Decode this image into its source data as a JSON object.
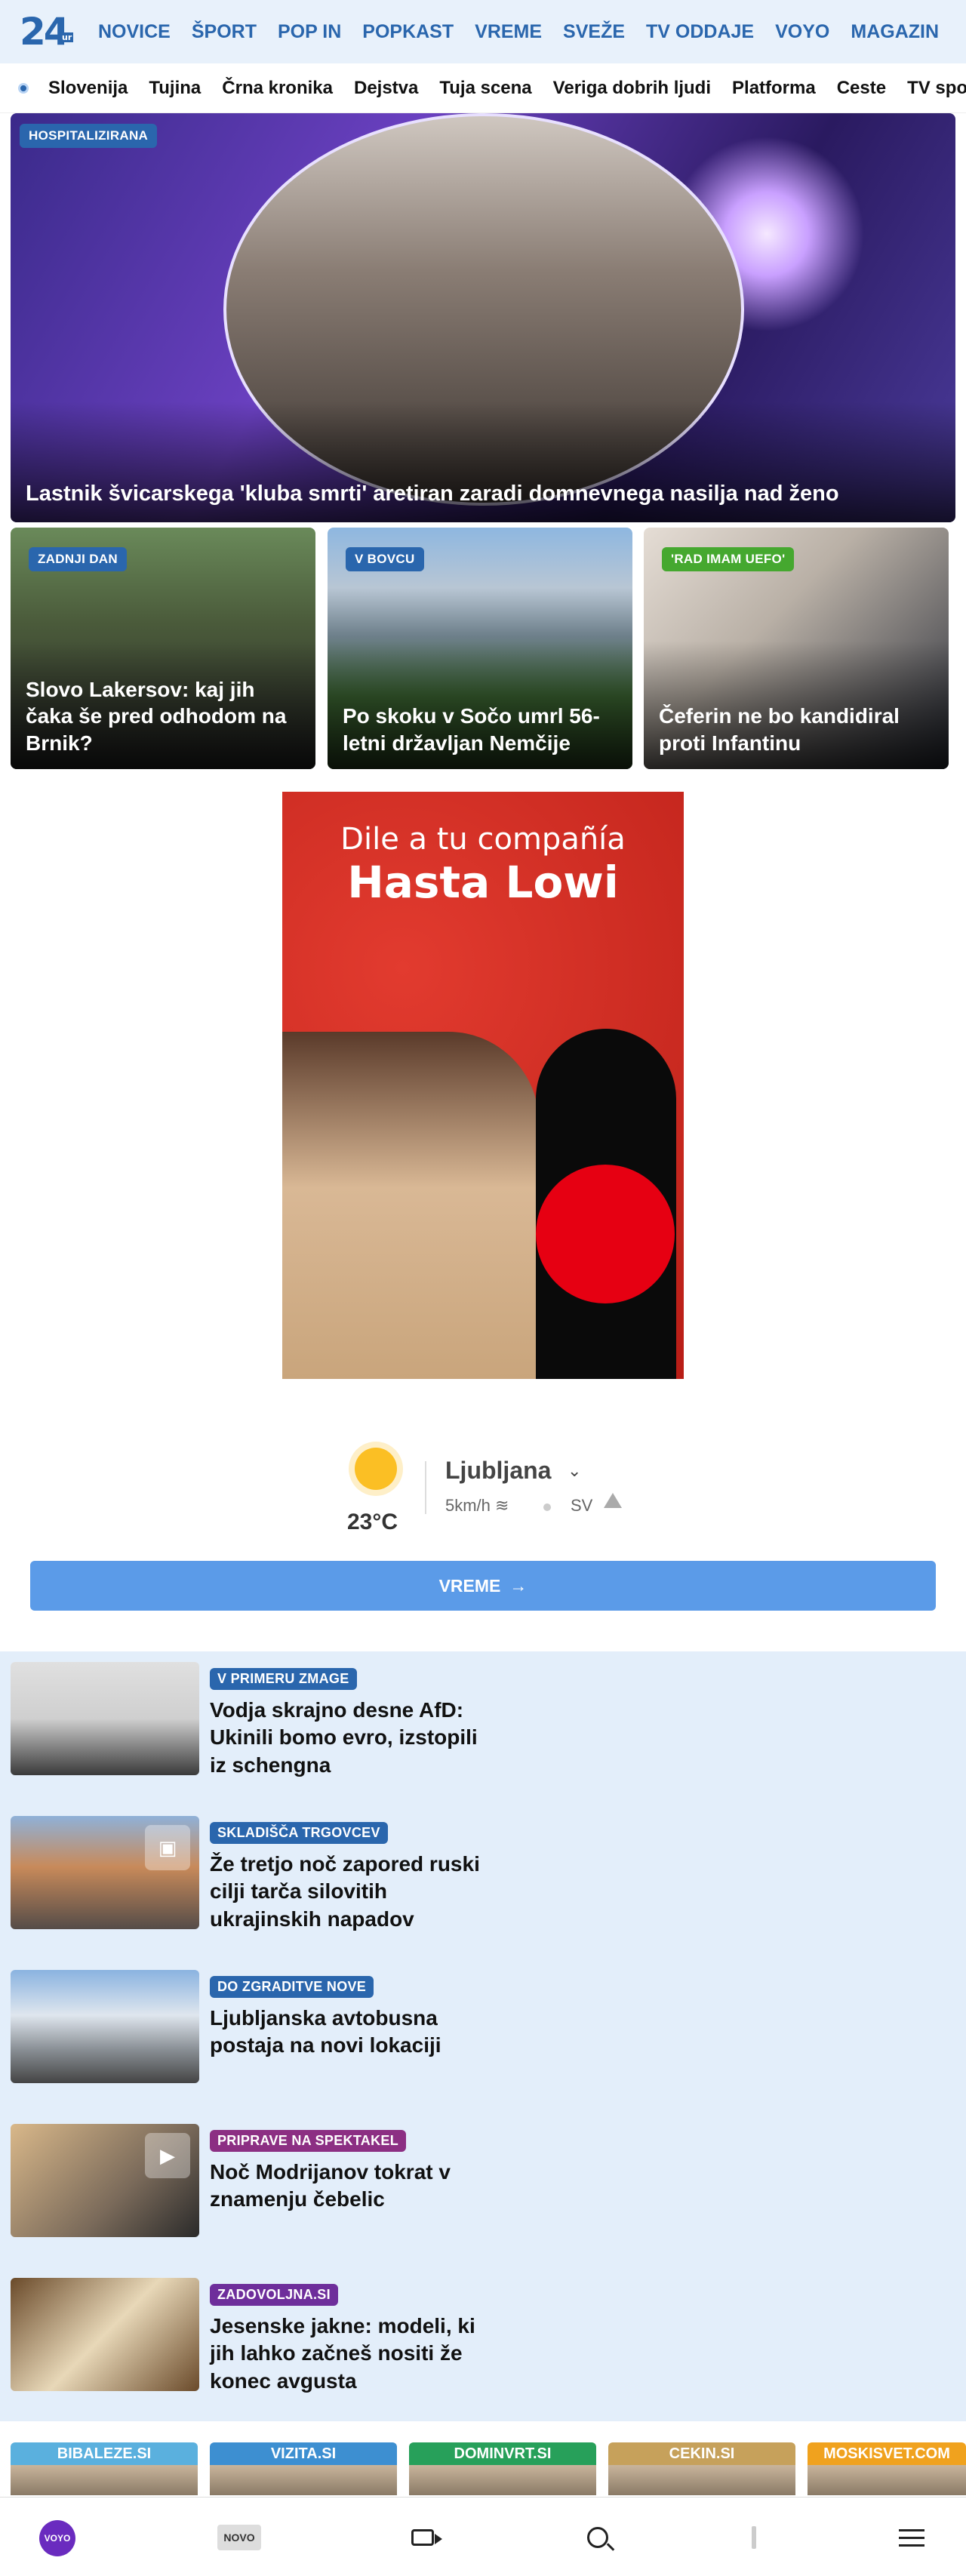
{
  "logo": {
    "main": "24",
    "sub": "ur"
  },
  "main_nav": [
    "NOVICE",
    "ŠPORT",
    "POP IN",
    "POPKAST",
    "VREME",
    "SVEŽE",
    "TV ODDAJE",
    "VOYO",
    "MAGAZIN"
  ],
  "sub_nav": [
    "Slovenija",
    "Tujina",
    "Črna kronika",
    "Dejstva",
    "Tuja scena",
    "Veriga dobrih ljudi",
    "Platforma",
    "Ceste",
    "TV spored"
  ],
  "hero": {
    "badge": "HOSPITALIZIRANA",
    "title": "Lastnik švicarskega 'kluba smrti' aretiran zaradi domnevnega nasilja nad ženo"
  },
  "cards": [
    {
      "badge": "ZADNJI DAN",
      "title": "Slovo Lakersov: kaj jih čaka še pred odhodom na Brnik?",
      "badge_color": "#2a66ad"
    },
    {
      "badge": "V BOVCU",
      "title": "Po skoku v Sočo umrl 56-letni državljan Nemčije",
      "badge_color": "#2a66ad"
    },
    {
      "badge": "'RAD IMAM UEFO'",
      "title": "Čeferin ne bo kandidiral proti Infantinu",
      "badge_color": "#45a82f"
    }
  ],
  "ad": {
    "line1": "Dile a tu compañía",
    "line2": "Hasta Lowi"
  },
  "weather": {
    "icon": "sun-icon",
    "temperature": "23°C",
    "city": "Ljubljana",
    "wind": "5km/h",
    "direction": "SV",
    "button_label": "VREME"
  },
  "articles": [
    {
      "badge": "V PRIMERU ZMAGE",
      "title": "Vodja skrajno desne AfD: Ukinili bomo evro, izstopili iz schengna",
      "badge_color": "#2a66ad",
      "media_icon": ""
    },
    {
      "badge": "SKLADIŠČA TRGOVCEV",
      "title": "Že tretjo noč zapored ruski cilji tarča silovitih ukrajinskih napadov",
      "badge_color": "#2a66ad",
      "media_icon": "gallery-icon"
    },
    {
      "badge": "DO ZGRADITVE NOVE",
      "title": "Ljubljanska avtobusna postaja na novi lokaciji",
      "badge_color": "#2a66ad",
      "media_icon": ""
    },
    {
      "badge": "PRIPRAVE NA SPEKTAKEL",
      "title": "Noč Modrijanov tokrat v znamenju čebelic",
      "badge_color": "#8c2f83",
      "media_icon": "video-icon"
    },
    {
      "badge": "ZADOVOLJNA.SI",
      "title": "Jesenske jakne: modeli, ki jih lahko začneš nositi že konec avgusta",
      "badge_color": "#6e2e9b",
      "media_icon": ""
    }
  ],
  "partners": [
    {
      "name": "BIBALEZE.SI",
      "color": "#5ab0de"
    },
    {
      "name": "VIZITA.SI",
      "color": "#3d8fd1"
    },
    {
      "name": "DOMINVRT.SI",
      "color": "#27a05a"
    },
    {
      "name": "CEKIN.SI",
      "color": "#c6a15b"
    },
    {
      "name": "MOSKISVET.COM",
      "color": "#f0a21e"
    }
  ],
  "bottom_nav": {
    "voyo": "VOYO",
    "novo": "NOVO"
  }
}
